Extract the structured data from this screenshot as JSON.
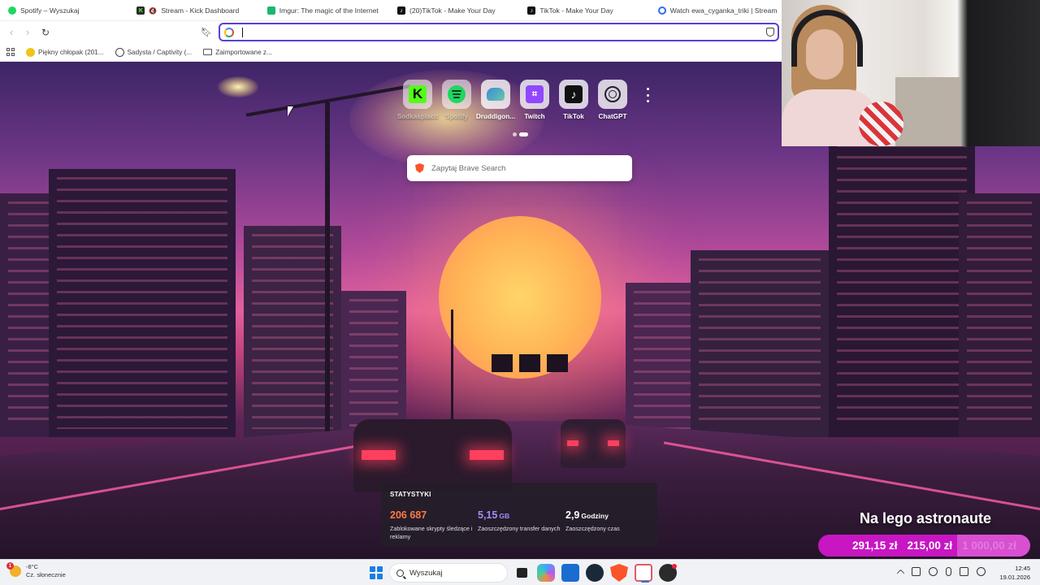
{
  "tabs": [
    {
      "title": "Spotify – Wyszukaj",
      "icon": "spotify-icon"
    },
    {
      "title": "Stream - Kick Dashboard",
      "icon": "kick-icon"
    },
    {
      "title": "Imgur: The magic of the Internet",
      "icon": "imgur-icon"
    },
    {
      "title": "(20)TikTok - Make Your Day",
      "icon": "tiktok-icon"
    },
    {
      "title": "TikTok - Make Your Day",
      "icon": "tiktok-icon"
    },
    {
      "title": "Watch ewa_cyganka_triki | Stream",
      "icon": "watch-icon"
    }
  ],
  "addressbar": {
    "value": ""
  },
  "bookmarks": [
    {
      "label": "Piękny chłopak (201..."
    },
    {
      "label": "Sadysta / Captivity (..."
    },
    {
      "label": "Zaimportowane z..."
    }
  ],
  "speeddial": [
    {
      "label": "Sodkasplacit",
      "icon": "kick-icon"
    },
    {
      "label": "Spotify",
      "icon": "spotify-icon"
    },
    {
      "label": "Druddigon...",
      "icon": "druddigon-icon"
    },
    {
      "label": "Twitch",
      "icon": "twitch-icon"
    },
    {
      "label": "TikTok",
      "icon": "tiktok-icon"
    },
    {
      "label": "ChatGPT",
      "icon": "chatgpt-icon"
    }
  ],
  "search": {
    "placeholder": "Zapytaj Brave Search"
  },
  "stats": {
    "title": "STATYSTYKI",
    "items": [
      {
        "value": "206 687",
        "unit": "",
        "desc": "Zablokowane skrypty śledzące i reklamy",
        "color": "#ff7a45"
      },
      {
        "value": "5,15",
        "unit": "GB",
        "desc": "Zaoszczędzony transfer danych",
        "color": "#a48bff"
      },
      {
        "value": "2,9",
        "unit": "Godziny",
        "desc": "Zaoszczędzony czas",
        "color": "#ffffff"
      }
    ]
  },
  "promo": {
    "title": "Na lego astronaute",
    "current": "291,15 zł",
    "goal": "215,00 zł",
    "goal_dim": "1 000,00 zł",
    "progress_percent": 100
  },
  "taskbar": {
    "weather_temp": "-8°C",
    "weather_desc": "Cz. słonecznie",
    "weather_badge": "1",
    "search_placeholder": "Wyszukaj",
    "time": "12:45",
    "date": "19.01.2026"
  },
  "colors": {
    "accent": "#5a3fd9",
    "promo": "#c716c2",
    "brave": "#fb542b"
  }
}
